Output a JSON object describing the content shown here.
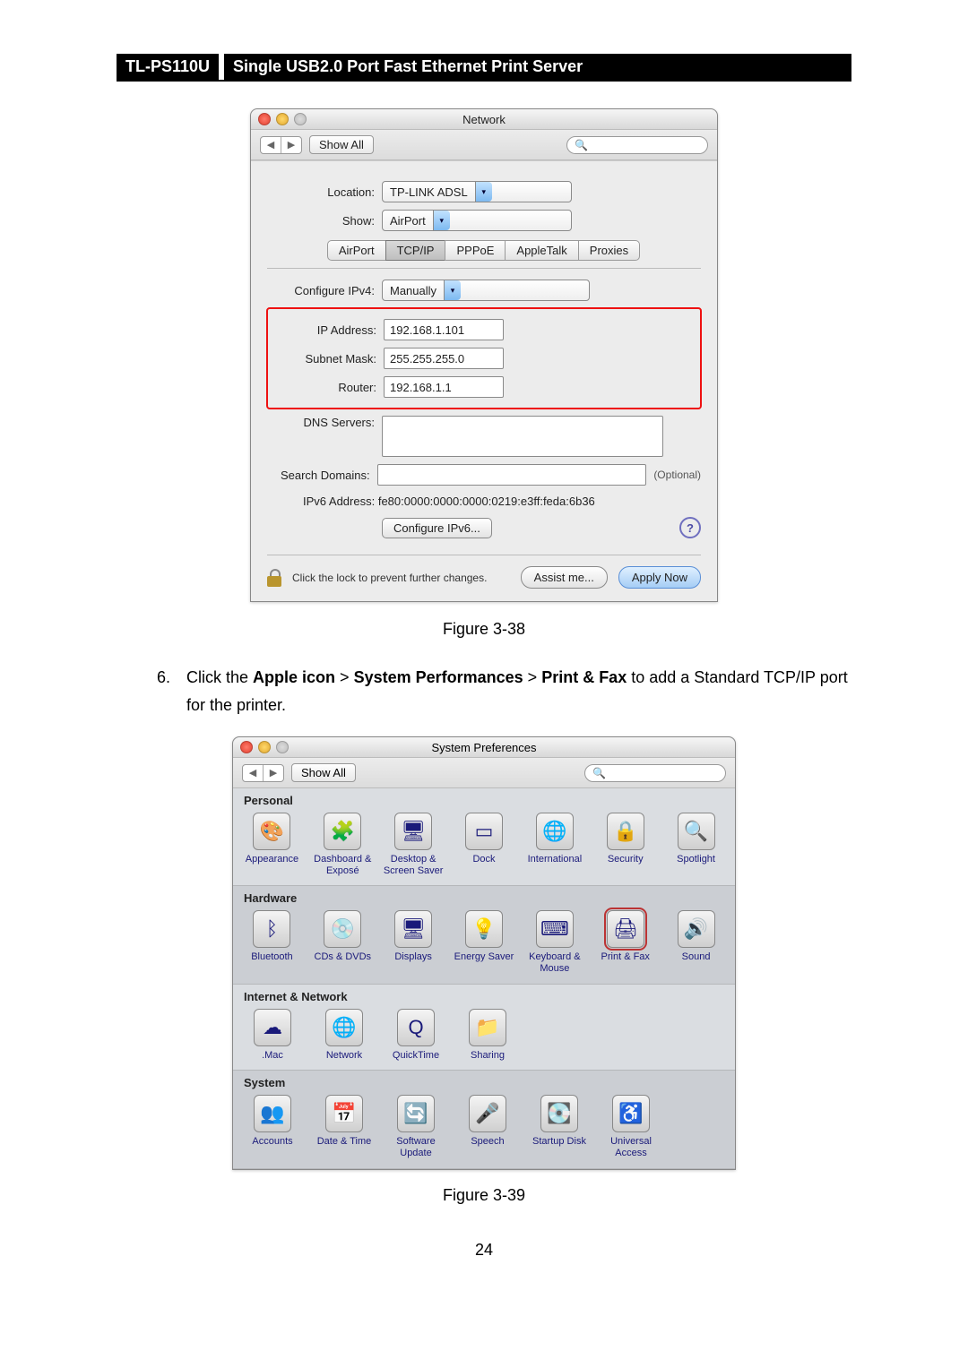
{
  "header": {
    "model": "TL-PS110U",
    "desc": "Single USB2.0 Port Fast Ethernet Print Server"
  },
  "network_window": {
    "title": "Network",
    "showall": "Show All",
    "nav_back": "◀",
    "nav_fwd": "▶",
    "search_icon": "🔍",
    "location_label": "Location:",
    "location_value": "TP-LINK ADSL",
    "show_label": "Show:",
    "show_value": "AirPort",
    "tabs": [
      "AirPort",
      "TCP/IP",
      "PPPoE",
      "AppleTalk",
      "Proxies"
    ],
    "active_tab": "TCP/IP",
    "configure_ipv4_label": "Configure IPv4:",
    "configure_ipv4_value": "Manually",
    "ip_label": "IP Address:",
    "ip_value": "192.168.1.101",
    "subnet_label": "Subnet Mask:",
    "subnet_value": "255.255.255.0",
    "router_label": "Router:",
    "router_value": "192.168.1.1",
    "dns_label": "DNS Servers:",
    "search_domains_label": "Search Domains:",
    "optional": "(Optional)",
    "ipv6_label": "IPv6 Address:",
    "ipv6_value": "fe80:0000:0000:0000:0219:e3ff:feda:6b36",
    "configure_ipv6_btn": "Configure IPv6...",
    "help": "?",
    "lock_text": "Click the lock to prevent further changes.",
    "assist_btn": "Assist me...",
    "apply_btn": "Apply Now"
  },
  "fig1": "Figure 3-38",
  "step": {
    "num": "6.",
    "pre": "Click the ",
    "b1": "Apple icon",
    "gt1": " > ",
    "b2": "System Performances",
    "gt2": " > ",
    "b3": "Print & Fax",
    "post": " to add a Standard TCP/IP port for the printer."
  },
  "sp_window": {
    "title": "System Preferences",
    "showall": "Show All",
    "nav_back": "◀",
    "nav_fwd": "▶",
    "search_icon": "🔍",
    "sections": [
      {
        "label": "Personal",
        "alt": false,
        "items": [
          {
            "label": "Appearance",
            "glyph": "🎨"
          },
          {
            "label": "Dashboard & Exposé",
            "glyph": "🧩"
          },
          {
            "label": "Desktop & Screen Saver",
            "glyph": "🖥"
          },
          {
            "label": "Dock",
            "glyph": "▭"
          },
          {
            "label": "International",
            "glyph": "🌐"
          },
          {
            "label": "Security",
            "glyph": "🔒"
          },
          {
            "label": "Spotlight",
            "glyph": "🔍"
          }
        ]
      },
      {
        "label": "Hardware",
        "alt": true,
        "items": [
          {
            "label": "Bluetooth",
            "glyph": "ᛒ"
          },
          {
            "label": "CDs & DVDs",
            "glyph": "💿"
          },
          {
            "label": "Displays",
            "glyph": "🖥"
          },
          {
            "label": "Energy Saver",
            "glyph": "💡"
          },
          {
            "label": "Keyboard & Mouse",
            "glyph": "⌨"
          },
          {
            "label": "Print & Fax",
            "glyph": "🖨",
            "hl": true
          },
          {
            "label": "Sound",
            "glyph": "🔊"
          }
        ]
      },
      {
        "label": "Internet & Network",
        "alt": false,
        "items": [
          {
            "label": ".Mac",
            "glyph": "☁"
          },
          {
            "label": "Network",
            "glyph": "🌐"
          },
          {
            "label": "QuickTime",
            "glyph": "Q"
          },
          {
            "label": "Sharing",
            "glyph": "📁"
          }
        ]
      },
      {
        "label": "System",
        "alt": true,
        "items": [
          {
            "label": "Accounts",
            "glyph": "👥"
          },
          {
            "label": "Date & Time",
            "glyph": "📅"
          },
          {
            "label": "Software Update",
            "glyph": "🔄"
          },
          {
            "label": "Speech",
            "glyph": "🎤"
          },
          {
            "label": "Startup Disk",
            "glyph": "💽"
          },
          {
            "label": "Universal Access",
            "glyph": "♿"
          }
        ]
      }
    ]
  },
  "fig2": "Figure 3-39",
  "page_number": "24"
}
